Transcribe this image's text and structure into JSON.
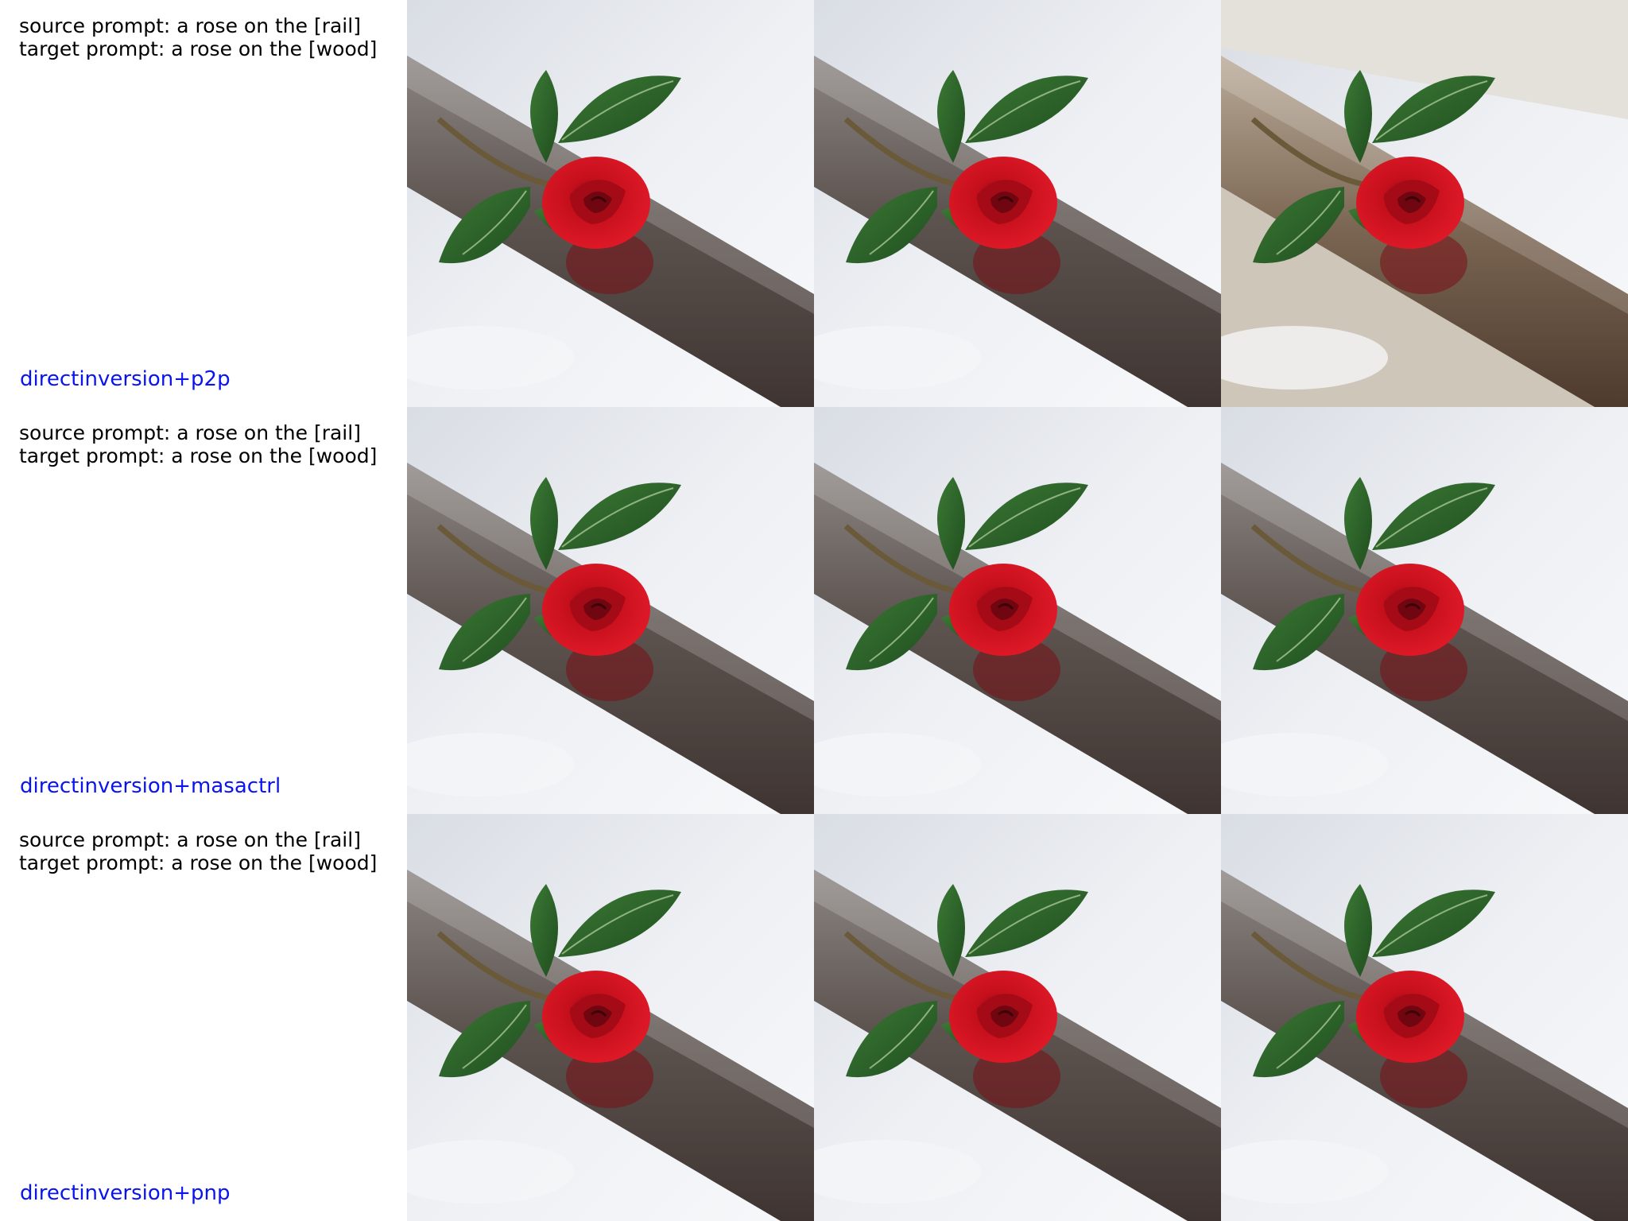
{
  "rows": [
    {
      "source_prompt": "source prompt: a rose on the [rail]",
      "target_prompt": "target prompt: a rose on the [wood]",
      "method": "directinversion+p2p",
      "images": [
        {
          "subject": "red rose on snowy rail",
          "variant": "source"
        },
        {
          "subject": "red rose on snowy rail",
          "variant": "reconstruction"
        },
        {
          "subject": "red rose on wooden beam",
          "variant": "edited"
        }
      ]
    },
    {
      "source_prompt": "source prompt: a rose on the [rail]",
      "target_prompt": "target prompt: a rose on the [wood]",
      "method": "directinversion+masactrl",
      "images": [
        {
          "subject": "red rose on snowy rail",
          "variant": "source"
        },
        {
          "subject": "red rose on snowy rail",
          "variant": "reconstruction"
        },
        {
          "subject": "red rose on snowy rail",
          "variant": "edited"
        }
      ]
    },
    {
      "source_prompt": "source prompt: a rose on the [rail]",
      "target_prompt": "target prompt: a rose on the [wood]",
      "method": "directinversion+pnp",
      "images": [
        {
          "subject": "red rose on snowy rail",
          "variant": "source"
        },
        {
          "subject": "red rose on snowy rail",
          "variant": "reconstruction"
        },
        {
          "subject": "red rose on snowy rail",
          "variant": "edited"
        }
      ]
    }
  ],
  "colors": {
    "method_label": "#0a14ee",
    "prompt_text": "#000000",
    "snow": "#eef0f3",
    "rail": "#5e5550",
    "wood": "#8a7866",
    "rose": "#d0101e",
    "leaf": "#2f6a2c"
  }
}
